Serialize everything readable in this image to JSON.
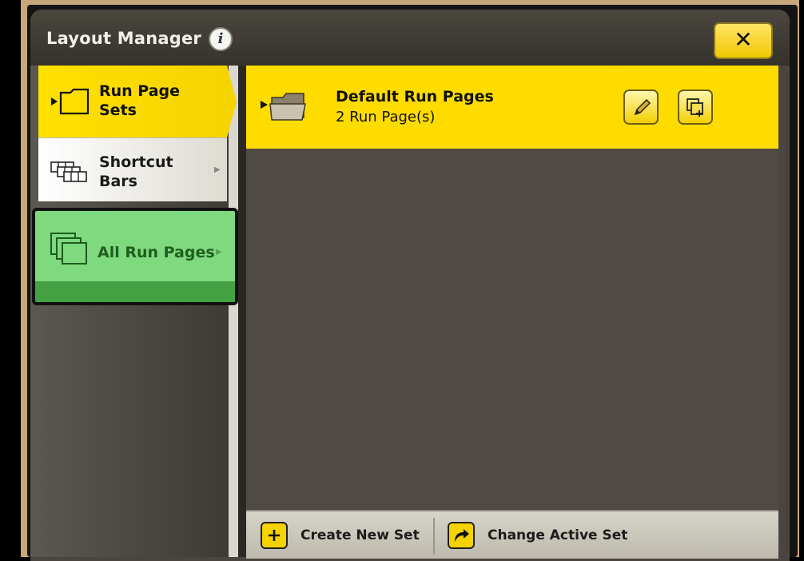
{
  "window": {
    "title": "Layout Manager",
    "info_icon": "info-icon",
    "close_label": "✕"
  },
  "sidebar": {
    "items": [
      {
        "label_line1": "Run Page",
        "label_line2": "Sets",
        "icon": "folder-run-icon",
        "state": "active"
      },
      {
        "label_line1": "Shortcut",
        "label_line2": "Bars",
        "icon": "shortcut-bars-icon",
        "state": "normal"
      },
      {
        "label_line1": "All Run Pages",
        "icon": "run-pages-stack-icon",
        "state": "highlighted"
      }
    ]
  },
  "content": {
    "sets": [
      {
        "title": "Default Run Pages",
        "subtitle": "2 Run Page(s)",
        "icon": "folder-run-icon"
      }
    ],
    "row_actions": [
      "edit-pencil-icon",
      "copy-icon"
    ]
  },
  "footer": {
    "create_label": "Create New Set",
    "change_label": "Change Active Set"
  },
  "colors": {
    "accent_yellow": "#ffdc00",
    "highlight_green": "#7fd97f",
    "panel_dark": "#4e4944"
  }
}
